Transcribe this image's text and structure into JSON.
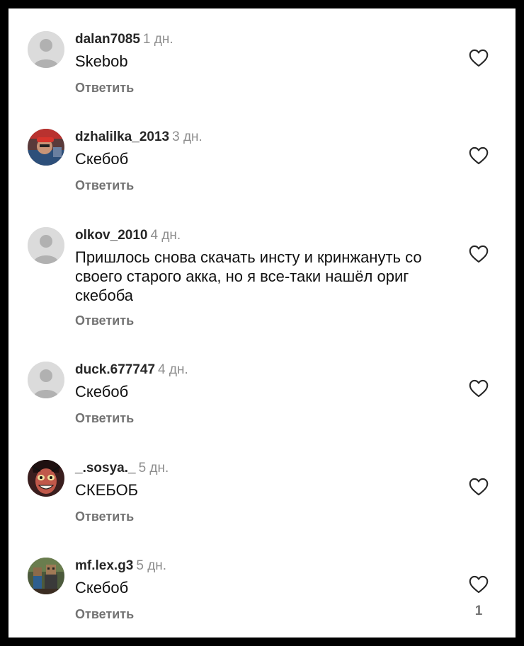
{
  "comments": [
    {
      "username": "dalan7085",
      "time": "1 дн.",
      "text": "Skebob",
      "reply_label": "Ответить",
      "avatar": "default-avatar"
    },
    {
      "username": "dzhalilka_2013",
      "time": "3 дн.",
      "text": "Скебоб",
      "reply_label": "Ответить",
      "avatar": "photo-avatar"
    },
    {
      "username": "olkov_2010",
      "time": "4 дн.",
      "text": "Пришлось снова скачать инсту и кринжануть со своего старого акка, но я все-таки нашёл ориг скебоба",
      "reply_label": "Ответить",
      "avatar": "default-avatar"
    },
    {
      "username": "duck.677747",
      "time": "4 дн.",
      "text": "Скебоб",
      "reply_label": "Ответить",
      "avatar": "default-avatar"
    },
    {
      "username": "_.sosya._",
      "time": "5 дн.",
      "text": "СКЕБОБ",
      "reply_label": "Ответить",
      "avatar": "cartoon-avatar"
    },
    {
      "username": "mf.lex.g3",
      "time": "5 дн.",
      "text": "Скебоб",
      "reply_label": "Ответить",
      "avatar": "pixel-avatar",
      "like_count": "1"
    }
  ],
  "colors": {
    "username": "#262626",
    "time": "#8e8e8e",
    "reply": "#737373",
    "background": "#ffffff"
  }
}
